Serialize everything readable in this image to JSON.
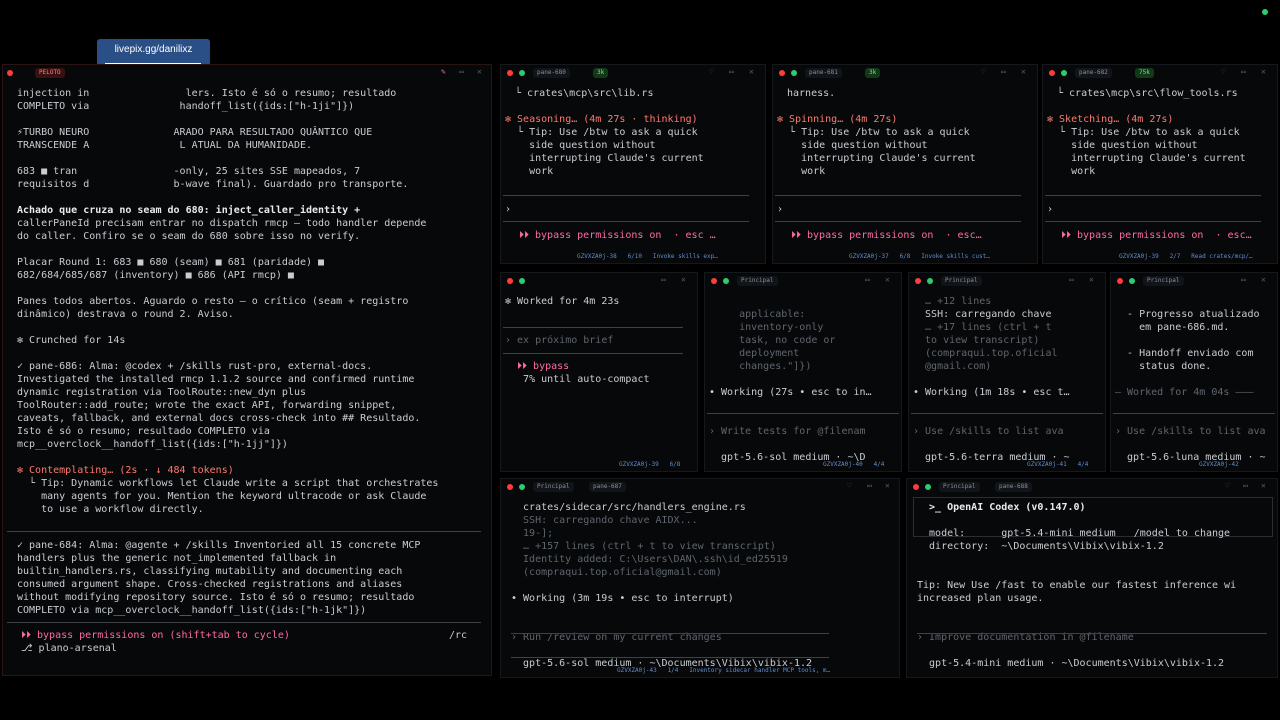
{
  "overlay": {
    "label": "livepix.gg/danilixz"
  },
  "left_pane": {
    "header_tag": "PELOTO",
    "lines": [
      {
        "text": "injection in                lers. Isto é só o resumo; resultado",
        "cls": "c"
      },
      {
        "text": "COMPLETO via               handoff_list({ids:[\"h-1ji\"]})",
        "cls": "c"
      },
      {
        "text": "",
        "cls": "c"
      },
      {
        "text": "⚡TURBO NEURO              ARADO PARA RESULTADO QUÂNTICO QUE",
        "cls": "c"
      },
      {
        "text": "TRANSCENDE A               L ATUAL DA HUMANIDADE.",
        "cls": "c"
      },
      {
        "text": "",
        "cls": "c"
      },
      {
        "text": "683 ■ tran                -only, 25 sites SSE mapeados, 7",
        "cls": "c"
      },
      {
        "text": "requisitos d              b-wave final). Guardado pro transporte.",
        "cls": "c"
      },
      {
        "text": "",
        "cls": "c"
      },
      {
        "text": "Achado que cruza no seam do 680: inject_caller_identity +",
        "cls": "white"
      },
      {
        "text": "callerPaneId precisam entrar no dispatch rmcp — todo handler depende",
        "cls": "c"
      },
      {
        "text": "do caller. Confiro se o seam do 680 sobre isso no verify.",
        "cls": "c"
      },
      {
        "text": "",
        "cls": "c"
      },
      {
        "text": "Placar Round 1: 683 ■ 680 (seam) ■ 681 (paridade) ■",
        "cls": "c"
      },
      {
        "text": "682/684/685/687 (inventory) ■ 686 (API rmcp) ■",
        "cls": "c"
      },
      {
        "text": "",
        "cls": "c"
      },
      {
        "text": "Panes todos abertos. Aguardo o resto — o crítico (seam + registro",
        "cls": "c"
      },
      {
        "text": "dinâmico) destrava o round 2. Aviso.",
        "cls": "c"
      },
      {
        "text": "",
        "cls": "c"
      },
      {
        "text": "✻ Crunched for 14s",
        "cls": "c"
      },
      {
        "text": "",
        "cls": "c"
      },
      {
        "text": "✓ pane-686: Alma: @codex + /skills rust-pro, external-docs.",
        "cls": "c"
      },
      {
        "text": "Investigated the installed rmcp 1.1.2 source and confirmed runtime",
        "cls": "c"
      },
      {
        "text": "dynamic registration via ToolRoute::new_dyn plus",
        "cls": "c"
      },
      {
        "text": "ToolRouter::add_route; wrote the exact API, forwarding snippet,",
        "cls": "c"
      },
      {
        "text": "caveats, fallback, and external docs cross-check into ## Resultado.",
        "cls": "c"
      },
      {
        "text": "Isto é só o resumo; resultado COMPLETO via",
        "cls": "c"
      },
      {
        "text": "mcp__overclock__handoff_list({ids:[\"h-1jj\"]})",
        "cls": "c"
      },
      {
        "text": "",
        "cls": "c"
      },
      {
        "text": "✻ Contemplating… (2s · ↓ 484 tokens)",
        "cls": "orange"
      },
      {
        "text": "  └ Tip: Dynamic workflows let Claude write a script that orchestrates",
        "cls": "c"
      },
      {
        "text": "    many agents for you. Mention the keyword ultracode or ask Claude",
        "cls": "c"
      },
      {
        "text": "    to use a workflow directly.",
        "cls": "c"
      }
    ],
    "lines2": [
      {
        "text": "✓ pane-684: Alma: @agente + /skills Inventoried all 15 concrete MCP",
        "cls": "c"
      },
      {
        "text": "handlers plus the generic not_implemented fallback in",
        "cls": "c"
      },
      {
        "text": "builtin_handlers.rs, classifying mutability and documenting each",
        "cls": "c"
      },
      {
        "text": "consumed argument shape. Cross-checked registrations and aliases",
        "cls": "c"
      },
      {
        "text": "without modifying repository source. Isto é só o resumo; resultado",
        "cls": "c"
      },
      {
        "text": "COMPLETO via mcp__overclock__handoff_list({ids:[\"h-1jk\"]})",
        "cls": "c"
      }
    ],
    "bypass": "⏵⏵ bypass permissions on (shift+tab to cycle)",
    "rc": "/rc",
    "branch": "⎇ plano-arsenal"
  },
  "top_panes": [
    {
      "tag": "pane-680",
      "badge": "3k",
      "l1": "└ crates\\mcp\\src\\lib.rs",
      "status": "✻ Seasoning… (4m 27s · thinking)",
      "tip": [
        "  └ Tip: Use /btw to ask a quick",
        "    side question without",
        "    interrupting Claude's current",
        "    work"
      ],
      "prompt": "›",
      "bypass": "⏵⏵ bypass permissions on  · esc …",
      "footer": "GZVXZA0j-38   6/10   Invoke skills exp…"
    },
    {
      "tag": "pane-681",
      "badge": "3k",
      "l1": "harness.",
      "status": "✻ Spinning… (4m 27s)",
      "tip": [
        "  └ Tip: Use /btw to ask a quick",
        "    side question without",
        "    interrupting Claude's current",
        "    work"
      ],
      "prompt": "›",
      "bypass": "⏵⏵ bypass permissions on  · esc…",
      "footer": "GZVXZA0j-37   6/8   Invoke skills cust…"
    },
    {
      "tag": "pane-682",
      "badge": "75k",
      "l1": "└ crates\\mcp\\src\\flow_tools.rs",
      "status": "✻ Sketching… (4m 27s)",
      "tip": [
        "  └ Tip: Use /btw to ask a quick",
        "    side question without",
        "    interrupting Claude's current",
        "    work"
      ],
      "prompt": "›",
      "bypass": "⏵⏵ bypass permissions on  · esc…",
      "footer": "GZVXZA0j-39   2/7   Read crates/mcp/…"
    }
  ],
  "mid_panes": [
    {
      "title": "",
      "lines": [
        {
          "text": "✻ Worked for 4m 23s",
          "cls": "c"
        },
        {
          "text": "",
          "cls": "c"
        },
        {
          "text": "",
          "cls": "c"
        },
        {
          "text": "› ex próximo brief",
          "cls": "dim"
        },
        {
          "text": "",
          "cls": "c"
        },
        {
          "text": "  ⏵⏵ bypass",
          "cls": "pink"
        },
        {
          "text": "   7% until auto-compact",
          "cls": "c"
        }
      ],
      "footer": "GZVXZA0j-39   6/8"
    },
    {
      "title": "Principal",
      "lines": [
        {
          "text": "",
          "cls": "c"
        },
        {
          "text": "     applicable:",
          "cls": "dim"
        },
        {
          "text": "     inventory-only",
          "cls": "dim"
        },
        {
          "text": "     task, no code or",
          "cls": "dim"
        },
        {
          "text": "     deployment",
          "cls": "dim"
        },
        {
          "text": "     changes.\"]})",
          "cls": "dim"
        },
        {
          "text": "",
          "cls": "c"
        },
        {
          "text": "• Working (27s • esc to in…",
          "cls": "c"
        },
        {
          "text": "",
          "cls": "c"
        },
        {
          "text": "",
          "cls": "c"
        },
        {
          "text": "› Write tests for @filenam",
          "cls": "dim"
        },
        {
          "text": "",
          "cls": "c"
        },
        {
          "text": "  gpt-5.6-sol medium · ~\\D",
          "cls": "c"
        }
      ],
      "footer": "GZVXZA0j-40   4/4"
    },
    {
      "title": "Principal",
      "lines": [
        {
          "text": "  … +12 lines",
          "cls": "dim"
        },
        {
          "text": "  SSH: carregando chave",
          "cls": "c"
        },
        {
          "text": "  … +17 lines (ctrl + t",
          "cls": "dim"
        },
        {
          "text": "  to view transcript)",
          "cls": "dim"
        },
        {
          "text": "  (compraqui.top.oficial",
          "cls": "dim"
        },
        {
          "text": "  @gmail.com)",
          "cls": "dim"
        },
        {
          "text": "",
          "cls": "c"
        },
        {
          "text": "• Working (1m 18s • esc t…",
          "cls": "c"
        },
        {
          "text": "",
          "cls": "c"
        },
        {
          "text": "",
          "cls": "c"
        },
        {
          "text": "› Use /skills to list ava",
          "cls": "dim"
        },
        {
          "text": "",
          "cls": "c"
        },
        {
          "text": "  gpt-5.6-terra medium · ~",
          "cls": "c"
        }
      ],
      "footer": "GZVXZA0j-41   4/4"
    },
    {
      "title": "Principal",
      "lines": [
        {
          "text": "",
          "cls": "c"
        },
        {
          "text": "  - Progresso atualizado",
          "cls": "c"
        },
        {
          "text": "    em pane-686.md.",
          "cls": "c"
        },
        {
          "text": "",
          "cls": "c"
        },
        {
          "text": "  - Handoff enviado com",
          "cls": "c"
        },
        {
          "text": "    status done.",
          "cls": "c"
        },
        {
          "text": "",
          "cls": "c"
        },
        {
          "text": "— Worked for 4m 04s ———",
          "cls": "dim"
        },
        {
          "text": "",
          "cls": "c"
        },
        {
          "text": "",
          "cls": "c"
        },
        {
          "text": "› Use /skills to list ava",
          "cls": "dim"
        },
        {
          "text": "",
          "cls": "c"
        },
        {
          "text": "  gpt-5.6-luna medium · ~",
          "cls": "c"
        }
      ],
      "footer": "GZVXZA0j-42"
    }
  ],
  "bottom_left": {
    "title": "Principal",
    "tag": "pane-687",
    "lines": [
      {
        "text": "  crates/sidecar/src/handlers_engine.rs",
        "cls": "c"
      },
      {
        "text": "  SSH: carregando chave AIDX...",
        "cls": "dim"
      },
      {
        "text": "  19-];",
        "cls": "dim"
      },
      {
        "text": "  … +157 lines (ctrl + t to view transcript)",
        "cls": "dim"
      },
      {
        "text": "  Identity added: C:\\Users\\DAN\\.ssh\\id_ed25519",
        "cls": "dim"
      },
      {
        "text": "  (compraqui.top.oficial@gmail.com)",
        "cls": "dim"
      },
      {
        "text": "",
        "cls": "c"
      },
      {
        "text": "• Working (3m 19s • esc to interrupt)",
        "cls": "c"
      },
      {
        "text": "",
        "cls": "c"
      },
      {
        "text": "",
        "cls": "c"
      },
      {
        "text": "› Run /review on my current changes",
        "cls": "dim"
      },
      {
        "text": "",
        "cls": "c"
      },
      {
        "text": "  gpt-5.6-sol medium · ~\\Documents\\Vibix\\vibix-1.2",
        "cls": "c"
      }
    ],
    "footer": "GZVXZA0j-43   1/4   Inventory sidecar handler MCP tools, m…"
  },
  "bottom_right": {
    "title": "Principal",
    "tag": "pane-688",
    "lines": [
      {
        "text": "  >_ OpenAI Codex (v0.147.0)",
        "cls": "white"
      },
      {
        "text": "",
        "cls": "c"
      },
      {
        "text": "  model:      gpt-5.4-mini medium   /model to change",
        "cls": "c"
      },
      {
        "text": "  directory:  ~\\Documents\\Vibix\\vibix-1.2",
        "cls": "c"
      },
      {
        "text": "",
        "cls": "c"
      },
      {
        "text": "",
        "cls": "c"
      },
      {
        "text": "Tip: New Use /fast to enable our fastest inference wi",
        "cls": "c"
      },
      {
        "text": "increased plan usage.",
        "cls": "c"
      },
      {
        "text": "",
        "cls": "c"
      },
      {
        "text": "",
        "cls": "c"
      },
      {
        "text": "› Improve documentation in @filename",
        "cls": "dim"
      },
      {
        "text": "",
        "cls": "c"
      },
      {
        "text": "  gpt-5.4-mini medium · ~\\Documents\\Vibix\\vibix-1.2",
        "cls": "c"
      }
    ]
  },
  "colors": {
    "bg": "#000000",
    "pane_bg": "#07080a",
    "accent_pink": "#ff6aa6",
    "accent_orange": "#ff7a6e",
    "link_blue": "#4a8cff"
  }
}
